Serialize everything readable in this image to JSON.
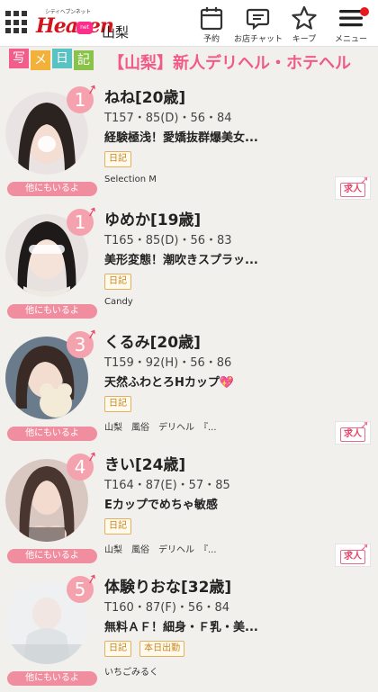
{
  "header": {
    "logo_sub": "シティヘブンネット",
    "logo_main": "Heaven",
    "logo_badge": "net",
    "area": "山梨",
    "buttons": [
      {
        "label": "予約",
        "icon": "calendar-icon"
      },
      {
        "label": "お店チャット",
        "icon": "chat-icon"
      },
      {
        "label": "キープ",
        "icon": "star-icon"
      },
      {
        "label": "メニュー",
        "icon": "hamburger-menu-icon"
      }
    ],
    "menu_badge_color": "#e8181f"
  },
  "banner": {
    "stamps": [
      "写",
      "メ",
      "日",
      "記"
    ],
    "stamp_colors": [
      "#f25d8a",
      "#f2b13a",
      "#59c3c3",
      "#8ac34a"
    ],
    "title": "【山梨】新人デリヘル・ホテヘル"
  },
  "common": {
    "more_label": "他にもいるよ",
    "recruit_label": "求人",
    "accent_color": "#f08ea0"
  },
  "cards": [
    {
      "rank": "1",
      "name": "ねね[20歳]",
      "stats": "T157・85(D)・56・84",
      "catch": "経験極浅！愛嬌抜群爆美女...",
      "tags": [
        "日記"
      ],
      "shop": "Selection M",
      "recruit": true
    },
    {
      "rank": "1",
      "name": "ゆめか[19歳]",
      "stats": "T165・85(D)・56・83",
      "catch": "美形変態！潮吹きスプラッ...",
      "tags": [
        "日記"
      ],
      "shop": "Candy",
      "recruit": false
    },
    {
      "rank": "3",
      "name": "くるみ[20歳]",
      "stats": "T159・92(H)・56・86",
      "catch": "天然ふわとろHカップ",
      "catch_emoji": "💖",
      "tags": [
        "日記"
      ],
      "shop": "山梨　風俗　デリヘル　『...",
      "recruit": true
    },
    {
      "rank": "4",
      "name": "きい[24歳]",
      "stats": "T164・87(E)・57・85",
      "catch": "Eカップでめちゃ敏感",
      "tags": [
        "日記"
      ],
      "shop": "山梨　風俗　デリヘル　『...",
      "recruit": true
    },
    {
      "rank": "5",
      "name": "体験りおな[32歳]",
      "stats": "T160・87(F)・56・84",
      "catch": "無料ＡＦ！細身・Ｆ乳・美...",
      "tags": [
        "日記",
        "本日出勤"
      ],
      "shop": "いちごみるく",
      "recruit": false
    }
  ]
}
